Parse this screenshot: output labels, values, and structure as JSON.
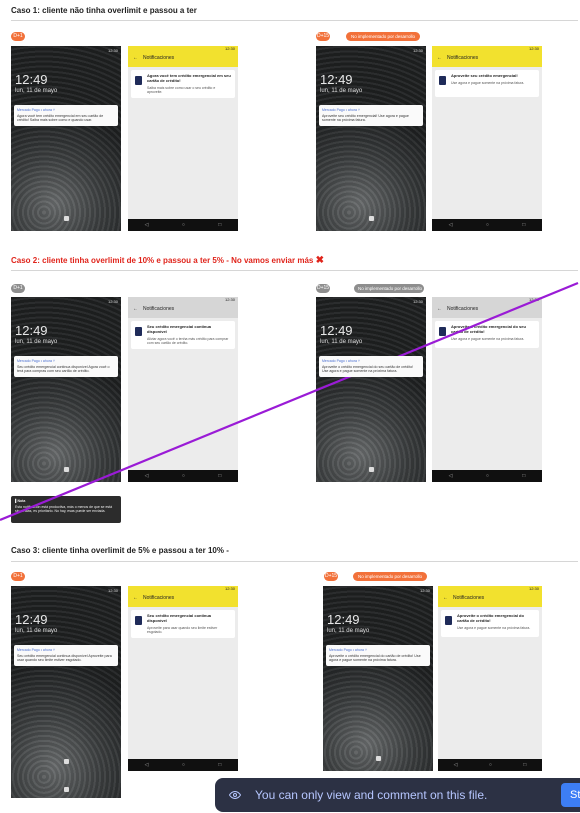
{
  "sections": [
    {
      "title": "Caso 1: cliente não tinha overlimit e passou a ter"
    },
    {
      "title": "Caso 2: cliente tinha overlimit de 10% e passou a ter 5% - No vamos enviar más"
    },
    {
      "title": "Caso 3: cliente tinha overlimit de 5% e passou a ter 10% -"
    }
  ],
  "badges": [
    "D+1",
    "D+15",
    "D+1",
    "D+15",
    "D+1",
    "D+15"
  ],
  "pills": [
    "No implementado por desarrollo",
    "No implementado por desarrollo",
    "No implementado por desarrollo"
  ],
  "lock": {
    "status": "12:30",
    "time": "12:49",
    "date": "lun, 11 de mayo",
    "app": "Mercado Pago • ahora ˅"
  },
  "lock_texts": [
    "Agora você tem crédito emergencial em seu cartão de crédito! Saiba mais sobre como e quando usar.",
    "Aproveite seu crédito emergencial! Use agora e pague somente na próxima fatura.",
    "Seu crédito emergencial continua disponível Agora você o terá para compras com seu cartão de crédito.",
    "Aproveite o crédito emergencial do seu cartão de crédito! Use agora e pague somente na próxima fatura.",
    "Seu crédito emergencial continua disponível Aproveite para usar quando seu limite estiver esgotado.",
    "Aproveite o crédito emergencial do cartão de crédito! Use agora e pague somente na próxima fatura."
  ],
  "notif": {
    "status": "12:30",
    "header": "Notificaciones",
    "nav": [
      "◁",
      "○",
      "□"
    ]
  },
  "notifs": [
    {
      "title": "Agora você tem crédito emergencial em seu cartão de crédito!",
      "sub": "Saiba mais sobre como usar o seu crédito e aproveite."
    },
    {
      "title": "Aproveite seu crédito emergencial!",
      "sub": "Use agora e pague somente na próxima fatura."
    },
    {
      "title": "Seu crédito emergencial continua disponível",
      "sub": "Aliviar agora você o tenha más crédito para comprar com seu cartão de crédito."
    },
    {
      "title": "Aproveite o crédito emergencial do seu cartão de crédito!",
      "sub": "Use agora e pague somente na próxima fatura."
    },
    {
      "title": "Seu crédito emergencial continua disponível",
      "sub": "Aproveite para usar quando seu limite estiver esgotado."
    },
    {
      "title": "Aproveite o crédito emergencial do cartão de crédito!",
      "sub": "Use agora e pague somente na próxima fatura."
    }
  ],
  "note": {
    "title": "Nota",
    "text": "Esta notificación está productiva, más o menos de que se está sin erratas, es prioritario. No hay, esas puede ser enviada."
  },
  "banner": {
    "text": "You can only view and comment on this file.",
    "button": "Sta"
  },
  "colors": {
    "orange": "#f2713a",
    "gray": "#8e8e8e",
    "yellow": "#f2e12e",
    "notifGray": "#d6d6d6",
    "purple": "#9a1bd6",
    "red": "#e0241b"
  }
}
